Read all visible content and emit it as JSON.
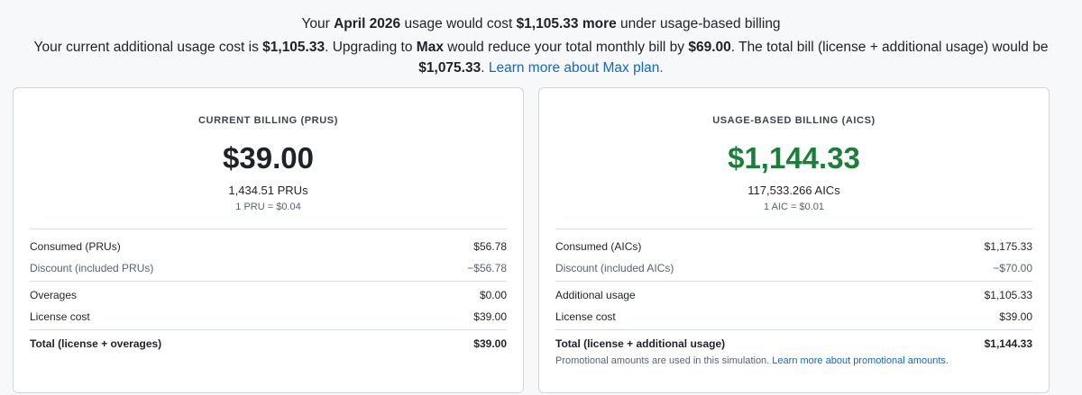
{
  "summary": {
    "headline": {
      "prefix": "Your ",
      "period": "April 2026",
      "mid": " usage would cost ",
      "amount": "$1,105.33 more",
      "suffix": " under usage-based billing"
    },
    "details": {
      "t1": "Your current additional usage cost is ",
      "current_cost": "$1,105.33",
      "t2": ". Upgrading to ",
      "plan": "Max",
      "t3": " would reduce your total monthly bill by ",
      "savings": "$69.00",
      "t4": ". The total bill (license + additional usage) would be ",
      "total": "$1,075.33",
      "t5": ". ",
      "learn_more": "Learn more about Max plan."
    }
  },
  "current_billing": {
    "title": "CURRENT BILLING (PRUS)",
    "amount": "$39.00",
    "units": "1,434.51 PRUs",
    "rate": "1 PRU = $0.04",
    "rows": [
      {
        "label": "Consumed (PRUs)",
        "value": "$56.78"
      },
      {
        "label": "Discount (included PRUs)",
        "value": "−$56.78"
      },
      {
        "label": "Overages",
        "value": "$0.00"
      },
      {
        "label": "License cost",
        "value": "$39.00"
      },
      {
        "label": "Total (license + overages)",
        "value": "$39.00"
      }
    ]
  },
  "usage_billing": {
    "title": "USAGE-BASED BILLING (AICS)",
    "amount": "$1,144.33",
    "units": "117,533.266 AICs",
    "rate": "1 AIC = $0.01",
    "rows": [
      {
        "label": "Consumed (AICs)",
        "value": "$1,175.33"
      },
      {
        "label": "Discount (included AICs)",
        "value": "−$70.00"
      },
      {
        "label": "Additional usage",
        "value": "$1,105.33"
      },
      {
        "label": "License cost",
        "value": "$39.00"
      },
      {
        "label": "Total (license + additional usage)",
        "value": "$1,144.33"
      }
    ],
    "note": "Promotional amounts are used in this simulation. ",
    "note_link": "Learn more about promotional amounts."
  },
  "colors": {
    "accent_link": "#0969da",
    "savings_green": "#1a7f37"
  }
}
